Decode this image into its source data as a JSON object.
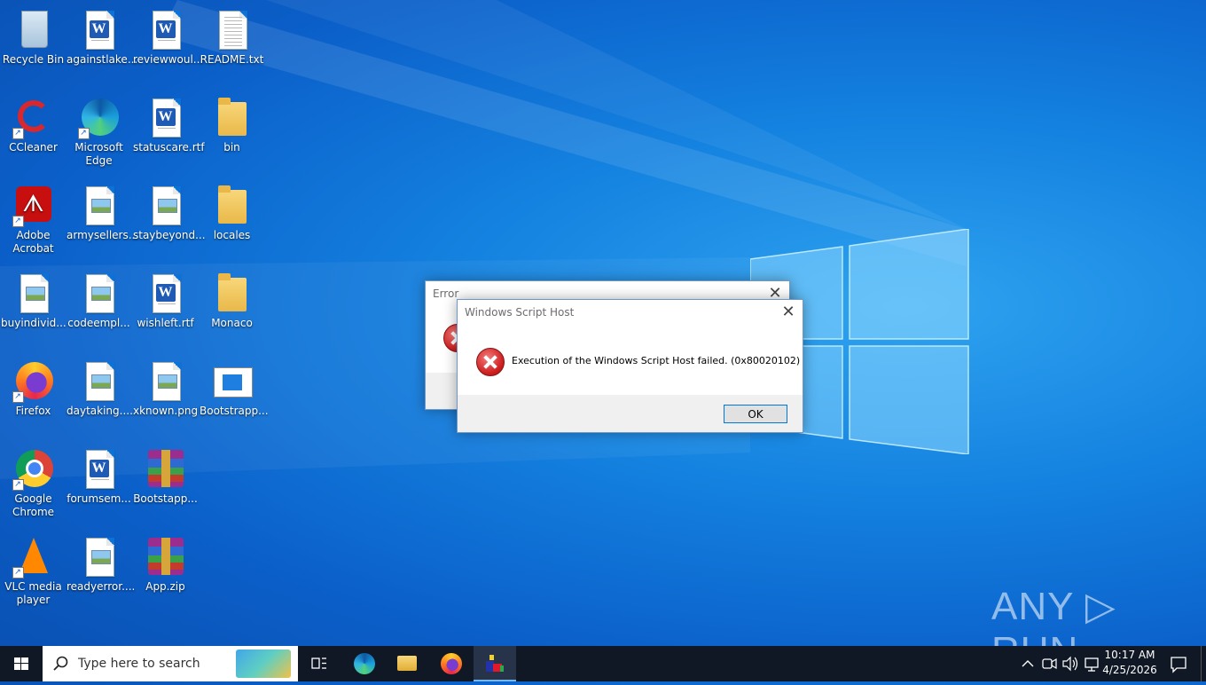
{
  "desktop": {
    "icons": [
      {
        "label": "Recycle Bin"
      },
      {
        "label": "againstlake..."
      },
      {
        "label": "reviewwoul..."
      },
      {
        "label": "README.txt"
      },
      {
        "label": "CCleaner"
      },
      {
        "label": "Microsoft Edge"
      },
      {
        "label": "statuscare.rtf"
      },
      {
        "label": "bin"
      },
      {
        "label": "Adobe Acrobat"
      },
      {
        "label": "armysellers..."
      },
      {
        "label": "staybeyond..."
      },
      {
        "label": "locales"
      },
      {
        "label": "buyindivid..."
      },
      {
        "label": "codeempl..."
      },
      {
        "label": "wishleft.rtf"
      },
      {
        "label": "Monaco"
      },
      {
        "label": "Firefox"
      },
      {
        "label": "daytaking...."
      },
      {
        "label": "xknown.png"
      },
      {
        "label": "Bootstrapp..."
      },
      {
        "label": "Google Chrome"
      },
      {
        "label": "forumsem..."
      },
      {
        "label": "Bootstapp..."
      },
      {
        "label": "VLC media player"
      },
      {
        "label": "readyerror...."
      },
      {
        "label": "App.zip"
      }
    ]
  },
  "error_dialog": {
    "title": "Error"
  },
  "wsh_dialog": {
    "title": "Windows Script Host",
    "message": "Execution of the Windows Script Host failed. (0x80020102)",
    "ok_label": "OK"
  },
  "watermark": {
    "text": "ANY ▷ RUN"
  },
  "taskbar": {
    "search_placeholder": "Type here to search",
    "time": "10:17 AM",
    "date": "4/25/2026"
  },
  "colors": {
    "desktop_blue": "#1482e0",
    "taskbar": "#101826",
    "accent": "#0078d7",
    "error_red": "#cf1f1f"
  }
}
